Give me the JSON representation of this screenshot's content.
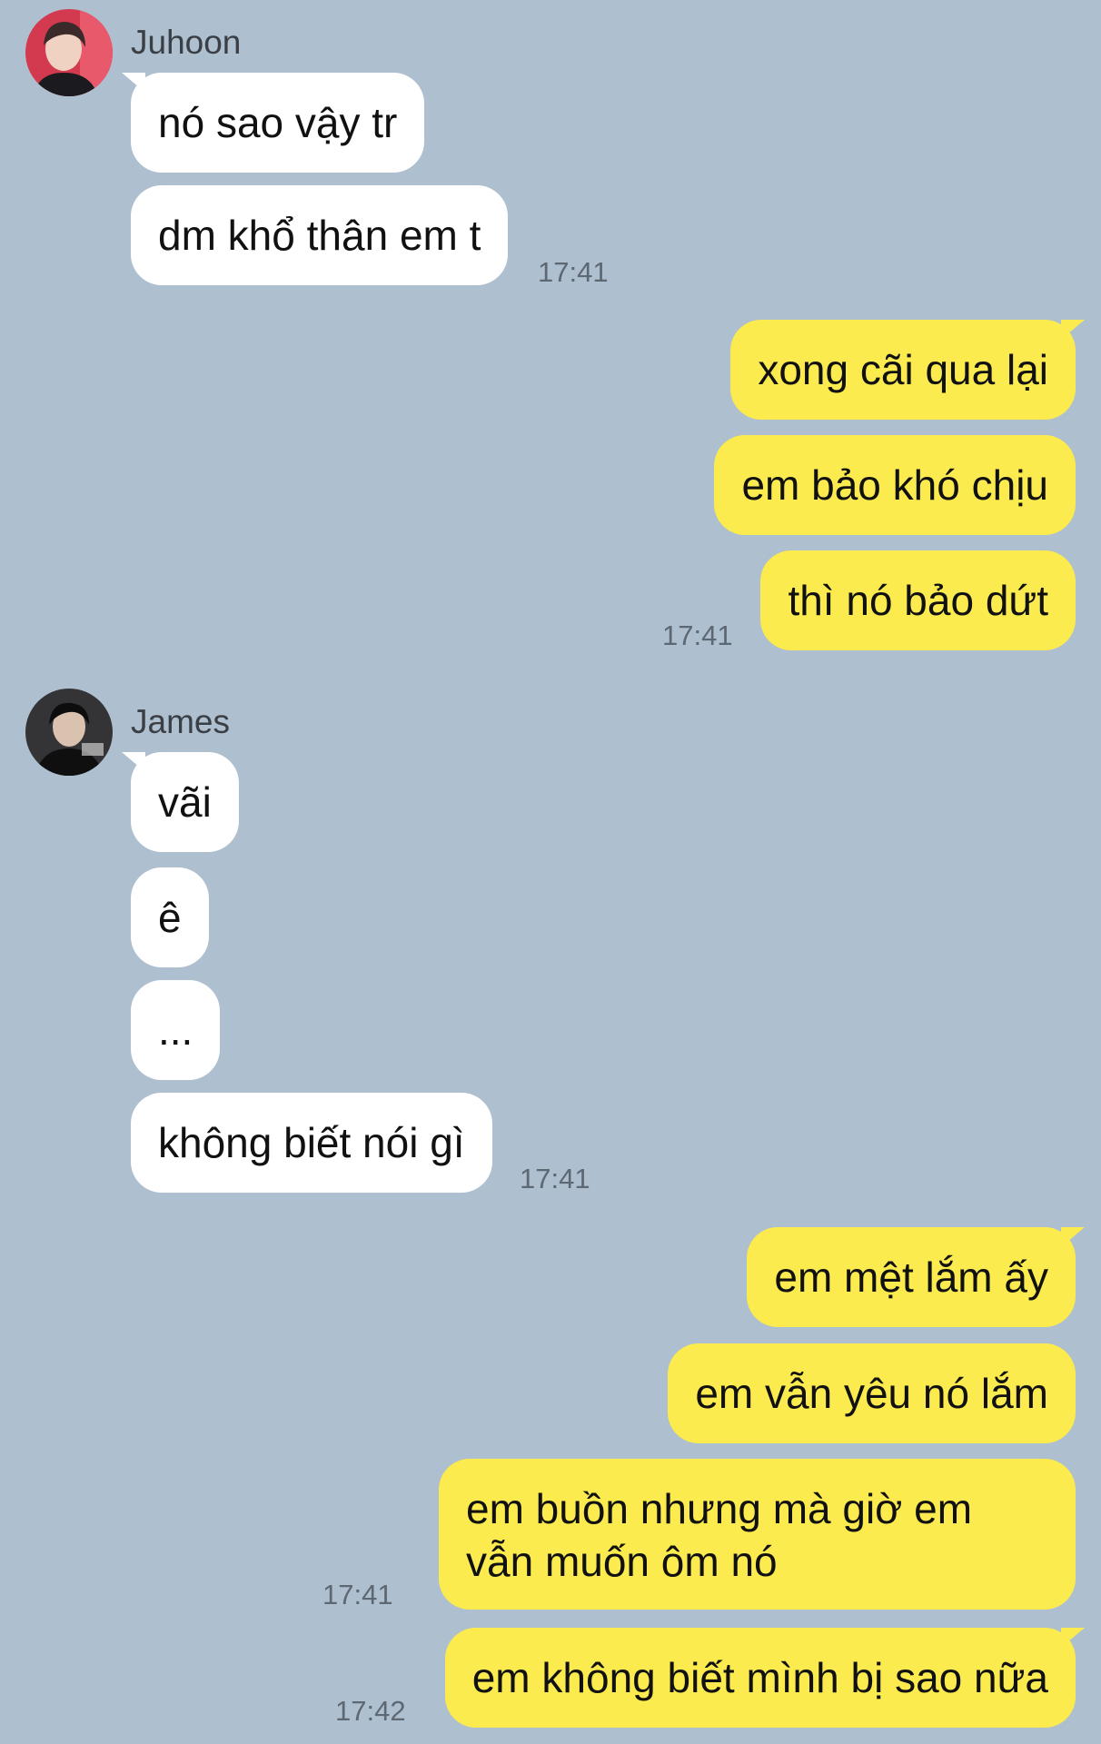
{
  "colors": {
    "background": "#aebfcf",
    "incoming_bubble": "#ffffff",
    "outgoing_bubble": "#fbeb4e",
    "timestamp": "#5d6873"
  },
  "groups": [
    {
      "sender": "Juhoon",
      "avatar": "avatar-photo-juhoon",
      "messages": [
        "nó sao vậy tr",
        "dm khổ thân em t"
      ],
      "time": "17:41"
    },
    {
      "sender": "me",
      "messages": [
        "xong cãi qua lại",
        "em bảo khó chịu",
        "thì nó bảo dứt"
      ],
      "time": "17:41"
    },
    {
      "sender": "James",
      "avatar": "avatar-photo-james",
      "messages": [
        "vãi",
        "ê",
        "...",
        "không biết nói gì"
      ],
      "time": "17:41"
    },
    {
      "sender": "me",
      "messages": [
        "em mệt lắm ấy",
        "em vẫn yêu nó lắm",
        "em buồn nhưng mà giờ em vẫn muốn ôm nó"
      ],
      "time": "17:41"
    },
    {
      "sender": "me",
      "messages": [
        "em không biết mình bị sao nữa"
      ],
      "time": "17:42"
    }
  ]
}
